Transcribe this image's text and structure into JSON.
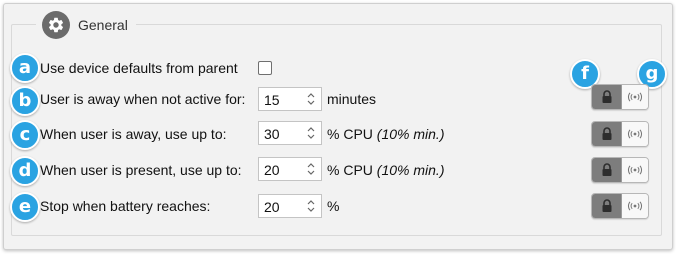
{
  "section": {
    "title": "General",
    "icon": "gear-icon"
  },
  "markers": [
    "a",
    "b",
    "c",
    "d",
    "e",
    "f",
    "g"
  ],
  "rows": [
    {
      "label": "Use device defaults from parent",
      "checked": false
    },
    {
      "label": "User is away when not active for:",
      "value": "15",
      "unit": "minutes"
    },
    {
      "label": "When user is away, use up to:",
      "value": "30",
      "unit": "% CPU",
      "note": "(10% min.)"
    },
    {
      "label": "When user is present, use up to:",
      "value": "20",
      "unit": "% CPU",
      "note": "(10% min.)"
    },
    {
      "label": "Stop when battery reaches:",
      "value": "20",
      "unit": "%"
    }
  ],
  "buttons": {
    "lock_icon": "lock-icon",
    "broadcast_icon": "broadcast-icon"
  },
  "colors": {
    "marker": "#2aa3e2",
    "lock_button": "#7d7d7d",
    "gear_circle": "#6b6b6b",
    "panel_background": "#f2f2f2"
  }
}
